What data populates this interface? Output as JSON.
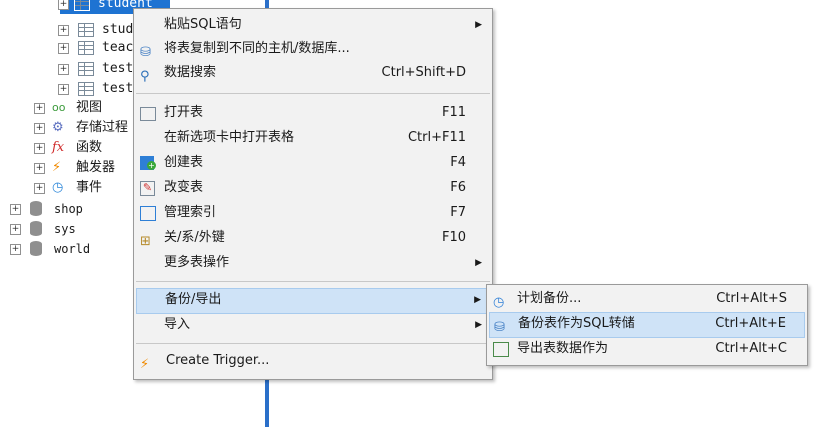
{
  "tree": {
    "tables": [
      "student",
      "stud",
      "teac",
      "test",
      "test"
    ],
    "folders": [
      "视图",
      "存储过程",
      "函数",
      "触发器",
      "事件"
    ],
    "databases": [
      "shop",
      "sys",
      "world"
    ]
  },
  "context_menu": {
    "items": [
      {
        "label": "粘贴SQL语句",
        "shortcut": "",
        "submenu": true
      },
      {
        "label": "将表复制到不同的主机/数据库...",
        "shortcut": ""
      },
      {
        "label": "数据搜索",
        "shortcut": "Ctrl+Shift+D"
      },
      {
        "label": "打开表",
        "shortcut": "F11"
      },
      {
        "label": "在新选项卡中打开表格",
        "shortcut": "Ctrl+F11"
      },
      {
        "label": "创建表",
        "shortcut": "F4"
      },
      {
        "label": "改变表",
        "shortcut": "F6"
      },
      {
        "label": "管理索引",
        "shortcut": "F7"
      },
      {
        "label": "关/系/外键",
        "shortcut": "F10"
      },
      {
        "label": "更多表操作",
        "shortcut": "",
        "submenu": true
      },
      {
        "label": "备份/导出",
        "shortcut": "",
        "submenu": true
      },
      {
        "label": "导入",
        "shortcut": "",
        "submenu": true
      },
      {
        "label": "Create Trigger...",
        "shortcut": ""
      }
    ]
  },
  "submenu": {
    "items": [
      {
        "label": "计划备份...",
        "shortcut": "Ctrl+Alt+S"
      },
      {
        "label": "备份表作为SQL转储",
        "shortcut": "Ctrl+Alt+E"
      },
      {
        "label": "导出表数据作为",
        "shortcut": "Ctrl+Alt+C"
      }
    ]
  },
  "colors": {
    "selection": "#1e73d2",
    "menu_bg": "#f2f2f2",
    "highlight": "#cfe3f7",
    "accent_line": "#2a6fc9"
  }
}
